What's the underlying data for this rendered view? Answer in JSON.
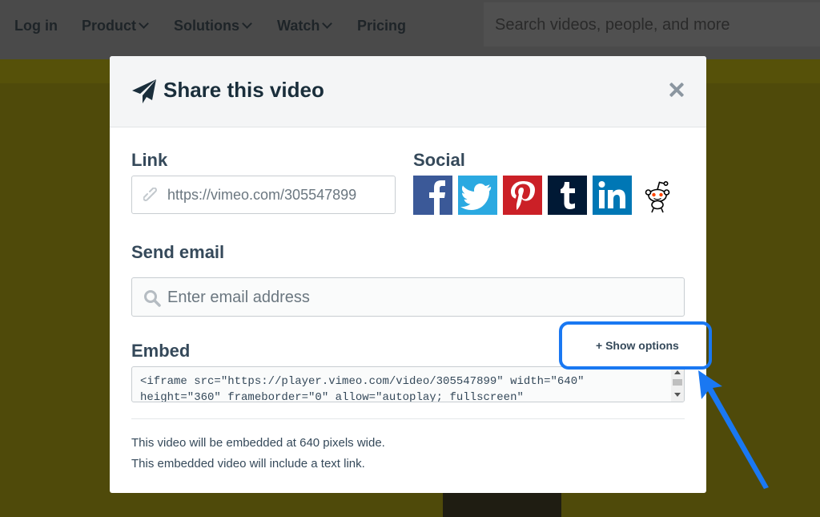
{
  "nav": {
    "login": "Log in",
    "product": "Product",
    "solutions": "Solutions",
    "watch": "Watch",
    "pricing": "Pricing",
    "search_placeholder": "Search videos, people, and more"
  },
  "modal": {
    "title": "Share this video",
    "link_label": "Link",
    "link_value": "https://vimeo.com/305547899",
    "social_label": "Social",
    "social_icons": [
      "facebook-icon",
      "twitter-icon",
      "pinterest-icon",
      "tumblr-icon",
      "linkedin-icon",
      "reddit-icon"
    ],
    "email_label": "Send email",
    "email_placeholder": "Enter email address",
    "embed_label": "Embed",
    "show_options": "+ Show options",
    "embed_code": "<iframe src=\"https://player.vimeo.com/video/305547899\" width=\"640\" height=\"360\" frameborder=\"0\" allow=\"autoplay; fullscreen\"",
    "info_width": "This video will be embedded at 640 pixels wide.",
    "info_link": "This embedded video will include a text link."
  },
  "colors": {
    "facebook": "#3b5998",
    "twitter": "#2ba9e1",
    "pinterest": "#cb2027",
    "tumblr": "#001935",
    "linkedin": "#0077b5",
    "highlight": "#1a78f2"
  }
}
